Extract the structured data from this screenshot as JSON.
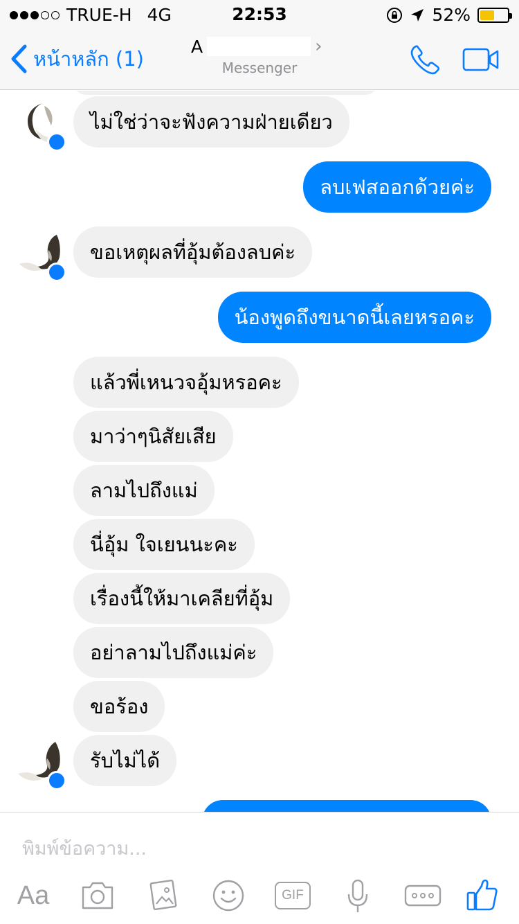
{
  "status_bar": {
    "carrier": "TRUE-H",
    "network": "4G",
    "time": "22:53",
    "battery_percent": "52%",
    "battery_level": 0.52,
    "signal_bars": 3,
    "signal_total": 5
  },
  "nav": {
    "back_label": "หน้าหลัก (1)",
    "title": "A",
    "subtitle": "Messenger"
  },
  "messages": [
    {
      "side": "in",
      "text": "ไม่ใช่ว่าจะฟังความฝ่ายเดียว",
      "avatar": true
    },
    {
      "side": "out",
      "text": "ลบเฟสออกด้วยค่ะ"
    },
    {
      "side": "in",
      "text": "ขอเหตุผลที่อุ้มต้องลบค่ะ",
      "avatar": true
    },
    {
      "side": "out",
      "text": "น้องพูดถึงขนาดนี้เลยหรอคะ"
    },
    {
      "side": "in",
      "text": "แล้วพี่เหนวจอุ้มหรอคะ"
    },
    {
      "side": "in",
      "text": "มาว่าๆนิสัยเสีย"
    },
    {
      "side": "in",
      "text": "ลามไปถึงแม่"
    },
    {
      "side": "in",
      "text": "นี่อุ้ม ใจเยนนะคะ"
    },
    {
      "side": "in",
      "text": "เรื่องนี้ให้มาเคลียที่อุ้ม"
    },
    {
      "side": "in",
      "text": "อย่าลามไปถึงแม่ค่ะ"
    },
    {
      "side": "in",
      "text": "ขอร้อง"
    },
    {
      "side": "in",
      "text": "รับไม่ได้",
      "avatar": true
    }
  ],
  "composer": {
    "placeholder": "พิมพ์ข้อความ...",
    "text_format_label": "Aa",
    "gif_label": "GIF"
  },
  "colors": {
    "accent": "#0a7cff",
    "outgoing_bubble": "#0084ff",
    "incoming_bubble": "#f1f0f0",
    "battery": "#f4c400"
  }
}
